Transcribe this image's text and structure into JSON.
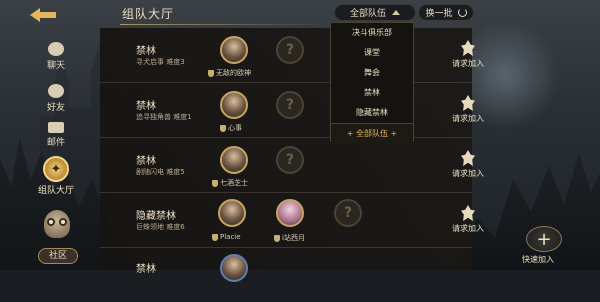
{
  "header": {
    "title": "组队大厅",
    "filter_label": "全部队伍",
    "refresh_label": "换一批"
  },
  "nav": {
    "items": [
      {
        "label": "聊天",
        "icon": "chat-icon"
      },
      {
        "label": "好友",
        "icon": "friends-icon"
      },
      {
        "label": "邮件",
        "icon": "mail-icon"
      },
      {
        "label": "组队大厅",
        "icon": "team-hall-icon",
        "active": true
      }
    ],
    "community_label": "社区"
  },
  "dropdown": {
    "options": [
      "决斗俱乐部",
      "课堂",
      "舞会",
      "禁林",
      "隐藏禁林",
      "全部队伍"
    ],
    "selected": "全部队伍"
  },
  "teams": [
    {
      "name": "禁林",
      "sub": "寻犬启事 难度3",
      "members": [
        "无敌的欧神"
      ],
      "join_label": "请求加入"
    },
    {
      "name": "禁林",
      "sub": "追寻独角兽 难度1",
      "members": [
        "心事"
      ],
      "join_label": "请求加入"
    },
    {
      "name": "禁林",
      "sub": "剧随闪电 难度5",
      "members": [
        "七酒芝士"
      ],
      "join_label": "请求加入"
    },
    {
      "name": "隐藏禁林",
      "sub": "巨蛛领地 难度6",
      "members": [
        "Placie",
        "i站西月"
      ],
      "join_label": "请求加入"
    },
    {
      "name": "禁林",
      "sub": "",
      "members": [],
      "join_label": ""
    }
  ],
  "quick_join_label": "快速加入",
  "colors": {
    "accent": "#e6b65c",
    "panel": "#17150f",
    "text": "#e8dcc0"
  }
}
